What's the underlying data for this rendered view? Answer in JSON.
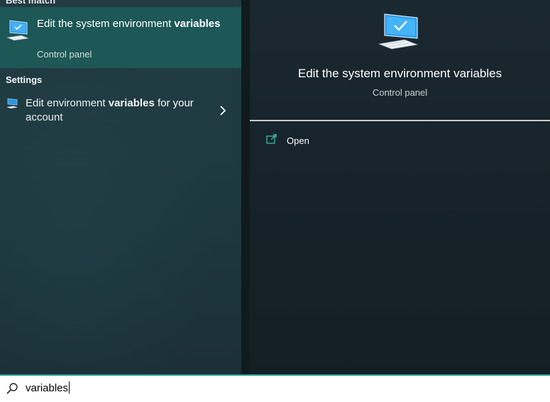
{
  "left": {
    "best_match_header": "Best match",
    "best_match": {
      "title_prefix": "Edit the system environment ",
      "title_bold": "variables",
      "subtitle": "Control panel"
    },
    "settings_header": "Settings",
    "settings_item": {
      "text_prefix": "Edit environment ",
      "text_bold": "variables",
      "text_suffix": " for your account"
    }
  },
  "right": {
    "title": "Edit the system environment variables",
    "subtitle": "Control panel",
    "actions": [
      {
        "label": "Open",
        "icon": "open-icon"
      }
    ]
  },
  "search": {
    "value": "variables"
  },
  "colors": {
    "accent": "#2aa39a",
    "selected_bg": "#1d5756",
    "icon_blue": "#2b9be8"
  }
}
